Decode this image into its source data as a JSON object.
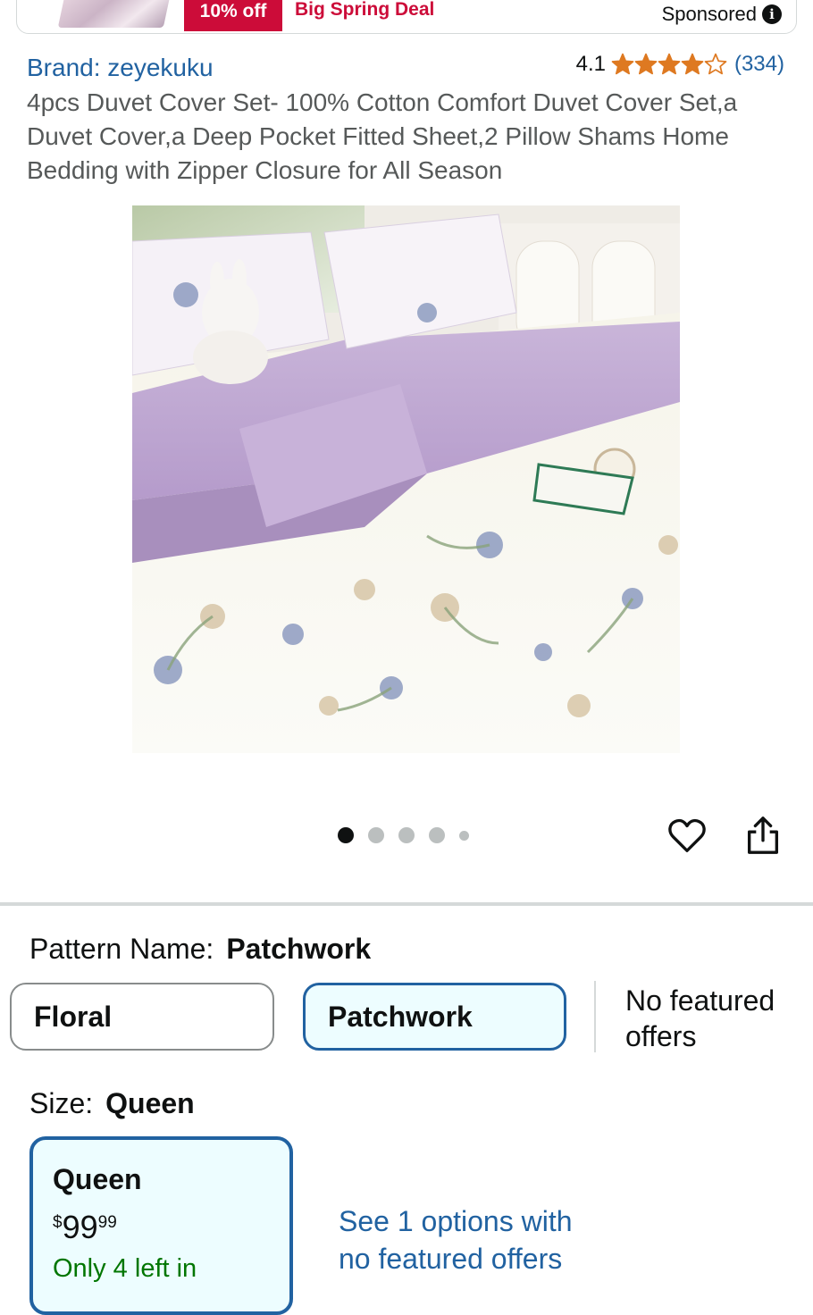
{
  "ad": {
    "discount": "10% off",
    "deal": "Big Spring Deal",
    "sponsored": "Sponsored",
    "info_icon": "info-icon"
  },
  "product": {
    "brand": "Brand: zeyekuku",
    "rating": "4.1",
    "stars_value": 4.1,
    "stars_max": 5,
    "review_count": "(334)",
    "title": "4pcs Duvet Cover Set- 100% Cotton Comfort Duvet Cover Set,a Duvet Cover,a Deep Pocket Fitted Sheet,2 Pillow Shams Home Bedding with Zipper Closure for All Season"
  },
  "gallery": {
    "image_count": 5,
    "active_index": 0,
    "icons": {
      "wishlist": "heart-icon",
      "share": "share-icon"
    }
  },
  "pattern": {
    "label": "Pattern Name:",
    "selected": "Patchwork",
    "options": [
      "Floral",
      "Patchwork"
    ],
    "no_offers": [
      "No featured",
      "offers"
    ]
  },
  "size": {
    "label": "Size:",
    "selected": "Queen",
    "card": {
      "name": "Queen",
      "price_symbol": "$",
      "price_whole": "99",
      "price_cents": "99",
      "stock": "Only 4 left in"
    },
    "see_options": [
      "See 1 options with",
      "no featured offers"
    ]
  },
  "colors": {
    "link": "#2162a1",
    "deal_red": "#cc0c39",
    "star": "#de7921",
    "stock_green": "#007600"
  }
}
